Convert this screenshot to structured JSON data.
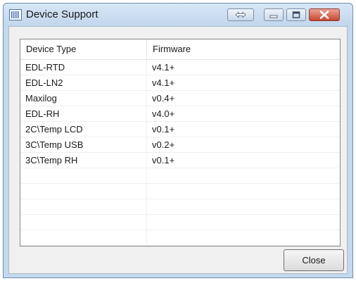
{
  "window": {
    "title": "Device Support",
    "icons": {
      "app": "device-bars-icon",
      "resize": "double-arrow-icon",
      "minimize": "minimize-icon",
      "maximize": "maximize-icon",
      "close": "close-icon"
    },
    "colors": {
      "frame": "#c4d9ee",
      "close_button": "#c8452f"
    }
  },
  "grid": {
    "columns": [
      "Device Type",
      "Firmware"
    ],
    "rows": [
      [
        "EDL-RTD",
        "v4.1+"
      ],
      [
        "EDL-LN2",
        "v4.1+"
      ],
      [
        "Maxilog",
        "v0.4+"
      ],
      [
        "EDL-RH",
        "v4.0+"
      ],
      [
        "2C\\Temp LCD",
        "v0.1+"
      ],
      [
        "3C\\Temp USB",
        "v0.2+"
      ],
      [
        "3C\\Temp RH",
        "v0.1+"
      ]
    ],
    "empty_rows": 6
  },
  "buttons": {
    "close_label": "Close"
  }
}
